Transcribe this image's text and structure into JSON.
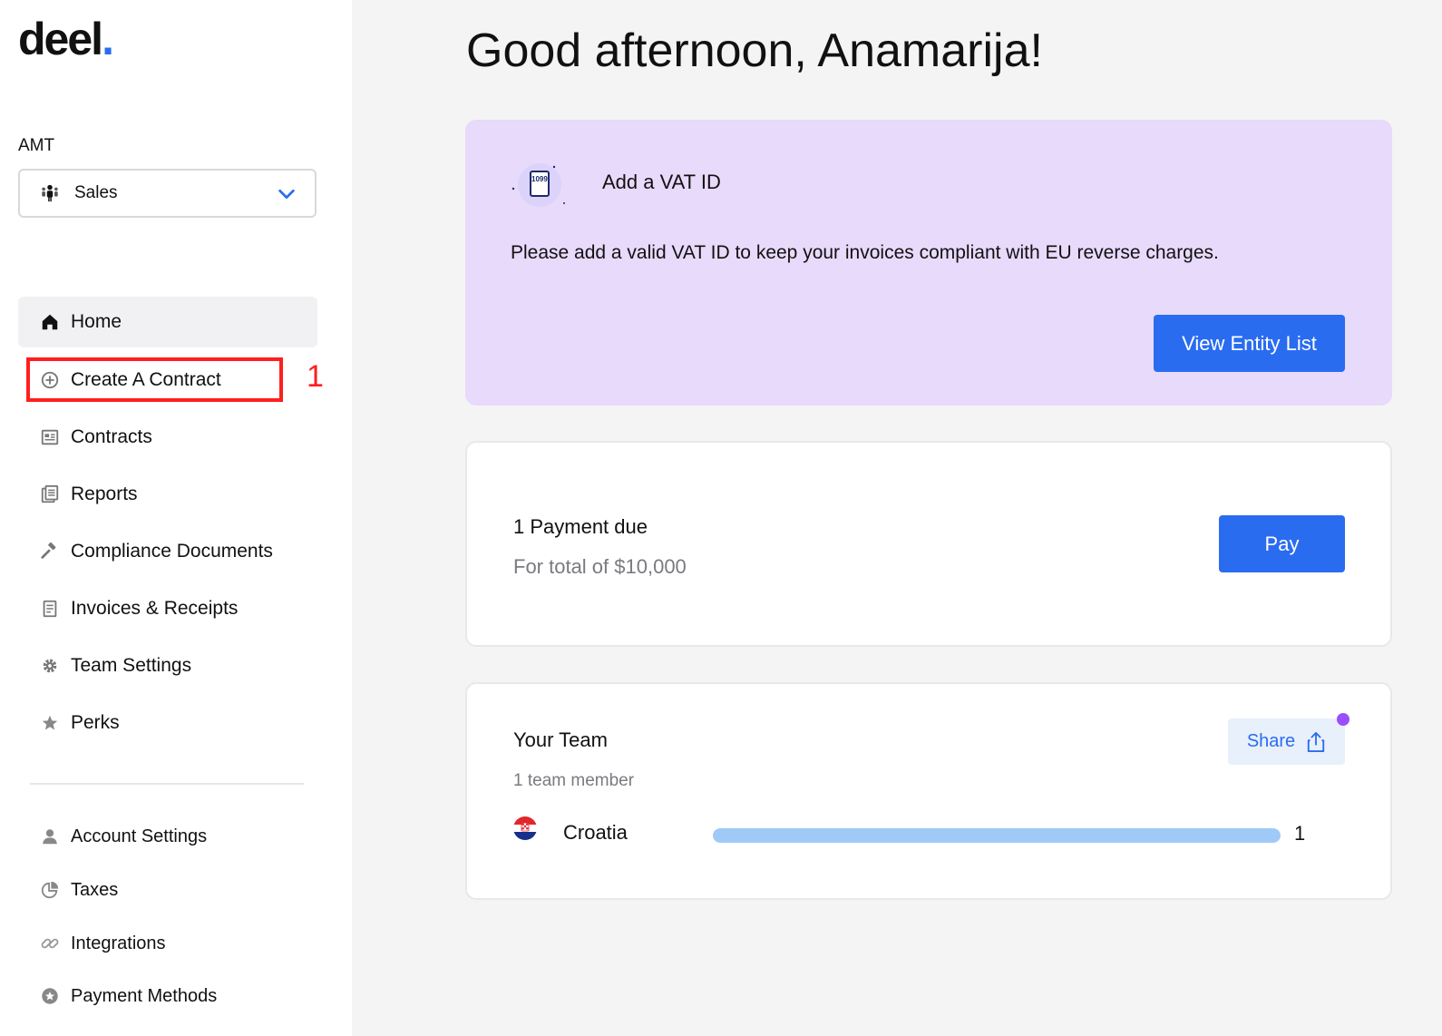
{
  "brand": {
    "name": "deel",
    "dot": ".",
    "accent": "#2a6cf0"
  },
  "sidebar": {
    "org_label": "AMT",
    "team_select": {
      "value": "Sales",
      "icon": "team-icon"
    },
    "nav": [
      {
        "label": "Home",
        "icon": "home-icon",
        "active": true
      },
      {
        "label": "Create A Contract",
        "icon": "plus-circle-icon"
      },
      {
        "label": "Contracts",
        "icon": "contracts-icon"
      },
      {
        "label": "Reports",
        "icon": "reports-icon"
      },
      {
        "label": "Compliance Documents",
        "icon": "gavel-icon"
      },
      {
        "label": "Invoices & Receipts",
        "icon": "invoice-icon"
      },
      {
        "label": "Team Settings",
        "icon": "gear-icon"
      },
      {
        "label": "Perks",
        "icon": "star-icon"
      }
    ],
    "secondary": [
      {
        "label": "Account Settings",
        "icon": "user-icon"
      },
      {
        "label": "Taxes",
        "icon": "pie-chart-icon"
      },
      {
        "label": "Integrations",
        "icon": "link-icon"
      },
      {
        "label": "Payment Methods",
        "icon": "payment-icon"
      }
    ],
    "annotation": {
      "step": "1",
      "color": "#ff1e1e"
    }
  },
  "main": {
    "greeting": "Good afternoon, Anamarija!",
    "vat_card": {
      "icon_text": "1099",
      "title": "Add a VAT ID",
      "description": "Please add a valid VAT ID to keep your invoices compliant with EU reverse charges.",
      "button": "View Entity List",
      "bg": "#e8dafb"
    },
    "payment_card": {
      "title": "1 Payment due",
      "subtitle": "For total of $10,000",
      "button": "Pay"
    },
    "team_card": {
      "title": "Your Team",
      "count_text": "1 team member",
      "share_label": "Share",
      "rows": [
        {
          "country": "Croatia",
          "count": "1",
          "fraction": 1.0,
          "flag": "croatia-flag"
        }
      ]
    }
  }
}
